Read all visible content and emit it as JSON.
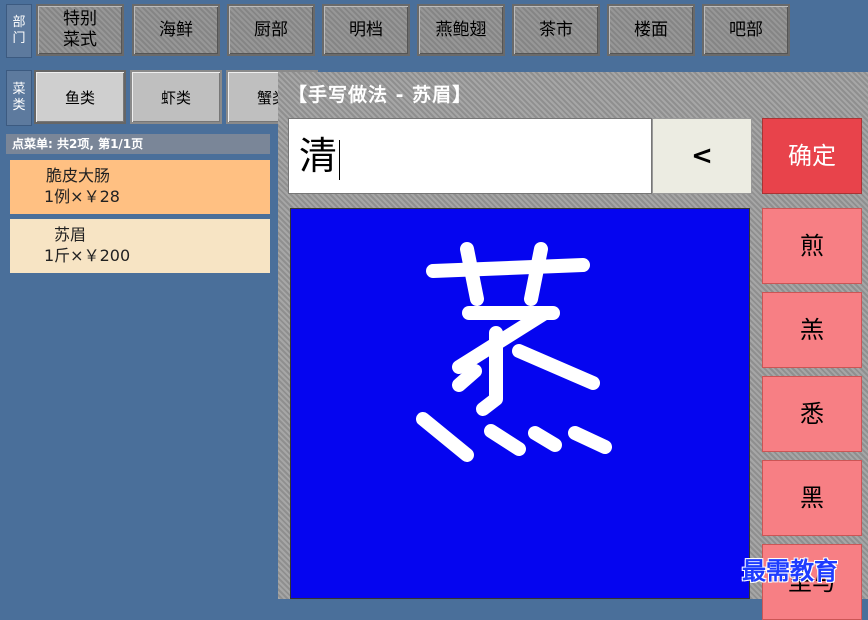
{
  "dept_label": "部门",
  "departments": [
    "特别\n菜式",
    "海鲜",
    "厨部",
    "明档",
    "燕鲍翅",
    "茶市",
    "楼面",
    "吧部"
  ],
  "cat_label": "菜类",
  "categories": [
    "鱼类",
    "虾类",
    "蟹类"
  ],
  "order": {
    "header": "点菜单: 共2项, 第1/1页",
    "items": [
      {
        "name": "脆皮大肠",
        "detail": "1例×￥28",
        "color": "#ffc082"
      },
      {
        "name": "苏眉",
        "detail": "1斤×￥200",
        "color": "#f7e4c4"
      }
    ]
  },
  "panel": {
    "title": "【手写做法 - 苏眉】",
    "input_value": "清",
    "backspace_label": "<",
    "confirm_label": "确定",
    "candidates": [
      "煎",
      "羔",
      "悉",
      "黑",
      "里与"
    ],
    "canvas_color": "#0505f0"
  },
  "watermark": "最需教育"
}
